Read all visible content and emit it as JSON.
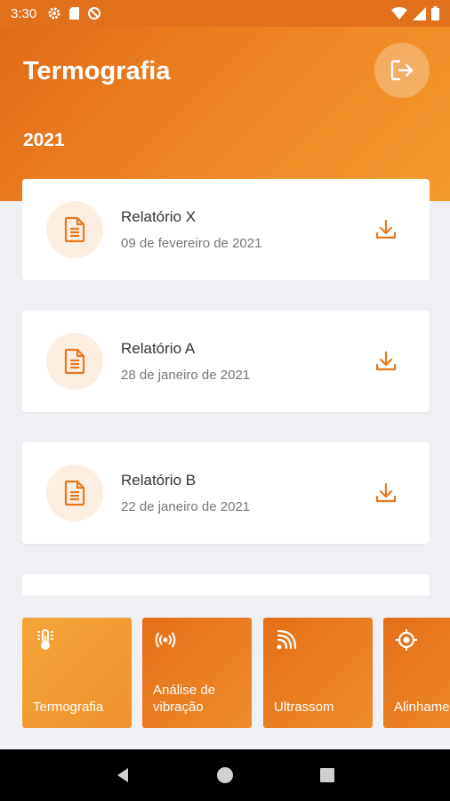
{
  "status_bar": {
    "time": "3:30",
    "icons_left": [
      "gear-icon",
      "sd-card-icon",
      "do-not-disturb-icon"
    ],
    "icons_right": [
      "wifi-icon",
      "signal-icon",
      "battery-icon"
    ]
  },
  "header": {
    "title": "Termografia",
    "year": "2021",
    "logout_icon": "logout-icon"
  },
  "reports": [
    {
      "title": "Relatório X",
      "date": "09 de fevereiro de 2021"
    },
    {
      "title": "Relatório A",
      "date": "28 de janeiro de 2021"
    },
    {
      "title": "Relatório B",
      "date": "22 de janeiro de 2021"
    }
  ],
  "menu": [
    {
      "label": "Termografia",
      "icon": "thermometer-icon"
    },
    {
      "label": "Análise de\nvibração",
      "icon": "vibration-icon"
    },
    {
      "label": "Ultrassom",
      "icon": "ultrasound-icon"
    },
    {
      "label": "Alinhamento",
      "icon": "crosshair-icon"
    }
  ],
  "colors": {
    "accent": "#e8781f",
    "tile_active": "#f29a30",
    "tile": "#e8781f",
    "background": "#eef0f4"
  }
}
